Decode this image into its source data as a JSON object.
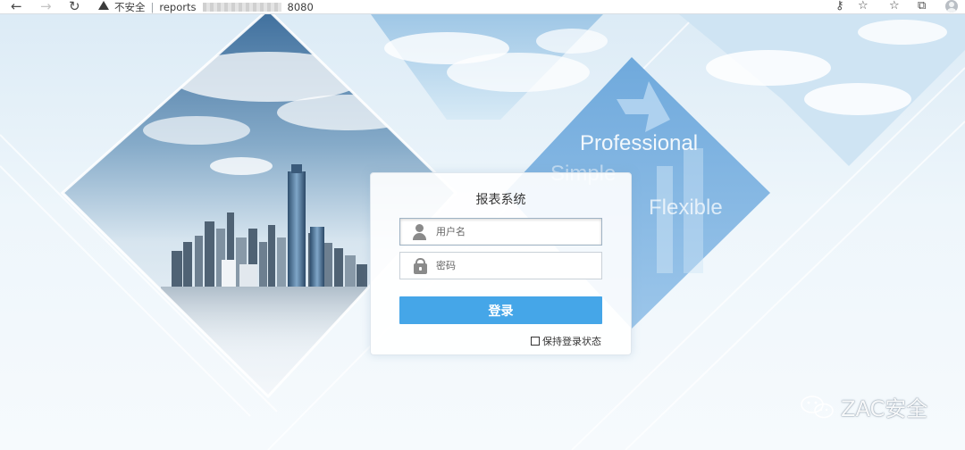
{
  "browser": {
    "security_label": "不安全",
    "url_prefix": "reports",
    "url_suffix": "8080"
  },
  "background": {
    "taglines": [
      "Professional",
      "Simple",
      "Flexible"
    ]
  },
  "login": {
    "title": "报表系统",
    "username_placeholder": "用户名",
    "password_placeholder": "密码",
    "submit_label": "登录",
    "remember_label": "保持登录状态",
    "remember_checked": false,
    "accent_color": "#45a6e8"
  },
  "watermark": {
    "text": "ZAC安全",
    "icon": "wechat-icon"
  }
}
